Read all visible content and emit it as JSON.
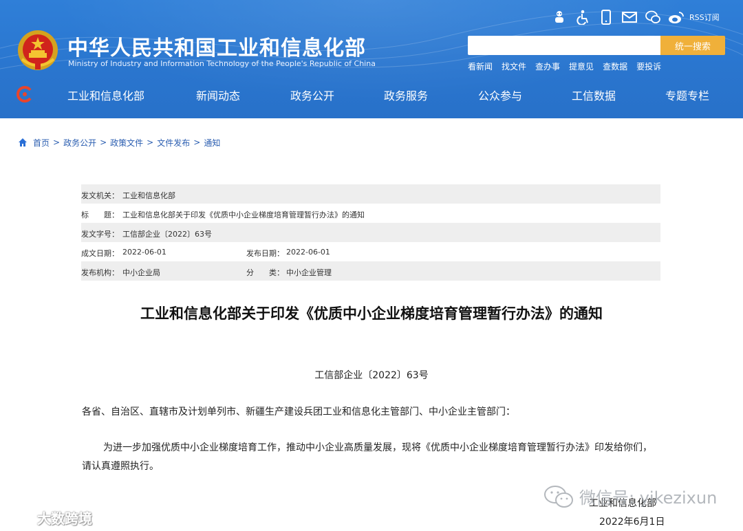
{
  "header": {
    "site_title": "中华人民共和国工业和信息化部",
    "site_subtitle": "Ministry of Industry and Information Technology of the People's Republic of China",
    "top_icons": [
      "robot-assistant-icon",
      "accessibility-icon",
      "mobile-phone-icon",
      "mail-icon",
      "wechat-icon",
      "weibo-icon"
    ],
    "rss_label": "RSS订阅",
    "search": {
      "placeholder": "",
      "button_label": "统一搜索"
    },
    "quick_links": [
      "看新闻",
      "找文件",
      "查办事",
      "提意见",
      "查数据",
      "要投诉"
    ],
    "nav": [
      "工业和信息化部",
      "新闻动态",
      "政务公开",
      "政务服务",
      "公众参与",
      "工信数据",
      "专题专栏"
    ]
  },
  "breadcrumb": [
    "首页",
    "政务公开",
    "政策文件",
    "文件发布",
    "通知"
  ],
  "meta": {
    "issuer_label": "发文机关：",
    "issuer": "工业和信息化部",
    "title_label": "标　　题：",
    "title": "工业和信息化部关于印发《优质中小企业梯度培育管理暂行办法》的通知",
    "doc_no_label": "发文字号：",
    "doc_no": "工信部企业〔2022〕63号",
    "created_label": "成文日期：",
    "created": "2022-06-01",
    "published_label": "发布日期：",
    "published": "2022-06-01",
    "agency_label": "发布机构：",
    "agency": "中小企业局",
    "category_label": "分　　类：",
    "category": "中小企业管理"
  },
  "article": {
    "title": "工业和信息化部关于印发《优质中小企业梯度培育管理暂行办法》的通知",
    "doc_number": "工信部企业〔2022〕63号",
    "addressee": "各省、自治区、直辖市及计划单列市、新疆生产建设兵团工业和信息化主管部门、中小企业主管部门：",
    "body": "为进一步加强优质中小企业梯度培育工作，推动中小企业高质量发展，现将《优质中小企业梯度培育管理暂行办法》印发给你们，请认真遵照执行。",
    "signature_org": "工业和信息化部",
    "signature_date": "2022年6月1日"
  },
  "watermarks": {
    "wechat": "微信号: yikezixun",
    "weibo": "大数跨境"
  },
  "colors": {
    "header_blue": "#2a76cf",
    "search_button": "#f0b03a",
    "breadcrumb_link": "#2a5db0",
    "meta_shade": "#eeeeee"
  }
}
